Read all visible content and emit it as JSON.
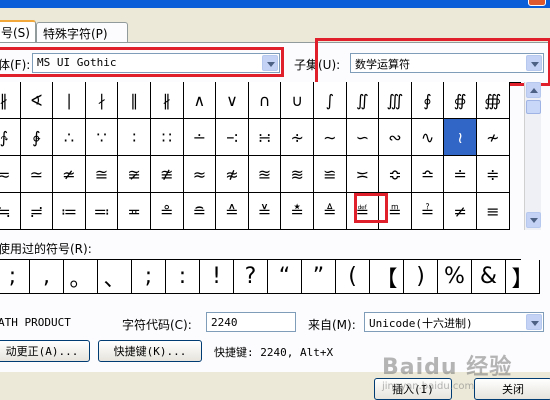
{
  "tabs": [
    {
      "label": "号(S)"
    },
    {
      "label": "特殊字符(P)"
    }
  ],
  "font": {
    "label": "体(F):",
    "value": "MS UI Gothic"
  },
  "subset": {
    "label": "子集(U):",
    "value": "数学运算符"
  },
  "grid": {
    "rows": [
      [
        "∦",
        "∢",
        "∣",
        "∤",
        "∥",
        "∦",
        "∧",
        "∨",
        "∩",
        "∪",
        "∫",
        "∬",
        "∭",
        "∮",
        "∯",
        "∰"
      ],
      [
        "∱",
        "∲",
        "∴",
        "∵",
        "∶",
        "∷",
        "∸",
        "∹",
        "∺",
        "∻",
        "∼",
        "∽",
        "∾",
        "∿",
        "≀",
        "≁"
      ],
      [
        "≂",
        "≃",
        "≄",
        "≅",
        "≆",
        "≇",
        "≈",
        "≉",
        "≊",
        "≋",
        "≌",
        "≍",
        "≎",
        "≏",
        "≐",
        "≑"
      ],
      [
        "≒",
        "≓",
        "≔",
        "≕",
        "≖",
        "≗",
        "≘",
        "≙",
        "≚",
        "≛",
        "≜",
        "≝",
        "≞",
        "≟",
        "≠",
        "≡"
      ]
    ],
    "selected": "≀"
  },
  "recent": {
    "label": "使用过的符号(R):",
    "symbols": [
      ";",
      ",",
      "。",
      "、",
      ";",
      ":",
      "!",
      "?",
      "“",
      "”",
      "(",
      "【",
      ")",
      "%",
      "&",
      "】"
    ]
  },
  "info": {
    "char_name": "ATH PRODUCT",
    "code_label": "字符代码(C):",
    "code_value": "2240",
    "from_label": "来自(M):",
    "from_value": "Unicode(十六进制)",
    "autocorrect_label": "动更正(A)...",
    "shortcut_label": "快捷键(K)...",
    "shortcut_text": "快捷键: 2240, Alt+X"
  },
  "buttons": {
    "insert": "插入(I)",
    "close": "关闭"
  },
  "watermark": {
    "text": "Baidu 经验",
    "sub": "jingyan.baidu.com"
  },
  "colors": {
    "highlight": "#e0202a",
    "selected": "#3165c6"
  }
}
